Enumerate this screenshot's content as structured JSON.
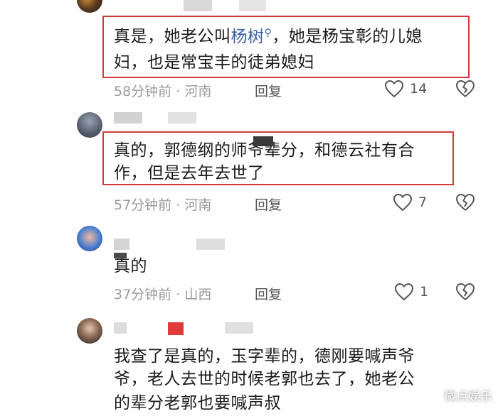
{
  "comments": [
    {
      "lines": [
        "真是，她老公叫",
        "妇，也是常宝丰的徒弟媳妇"
      ],
      "link": "杨树",
      "line1_tail": "，她是杨宝彰的儿媳",
      "time": "58分钟前",
      "location": "河南",
      "reply": "回复",
      "likes": "14"
    },
    {
      "lines": [
        "真的，郭德纲的师爷辈分，和德云社有合",
        "作，但是去年去世了"
      ],
      "time": "57分钟前",
      "location": "河南",
      "reply": "回复",
      "likes": "7"
    },
    {
      "lines": [
        "真的"
      ],
      "time": "37分钟前",
      "location": "山西",
      "reply": "回复",
      "likes": "1"
    },
    {
      "lines": [
        "我查了是真的，玉字辈的，德刚要喊声爷",
        "爷，老人去世的时候老郭也去了，她老公",
        "的辈分老郭也要喊声叔"
      ]
    }
  ],
  "meta_separator": "·",
  "watermark": {
    "text": "微点娱乐"
  },
  "colors": {
    "highlight_border": "#d23a3a",
    "link": "#3a5fa8",
    "meta": "#9a9a9a"
  }
}
